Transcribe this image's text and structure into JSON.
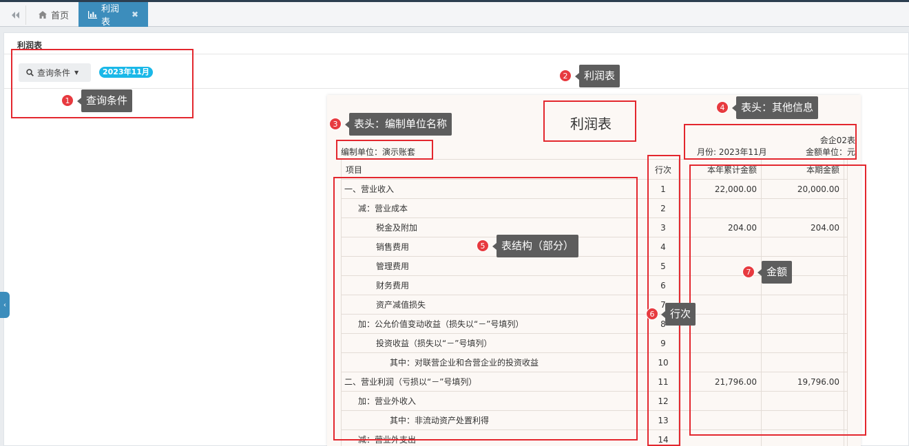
{
  "tabs": [
    {
      "label": "首页",
      "icon": "home-icon"
    },
    {
      "label": "利润表",
      "icon": "bar-chart-icon",
      "close": "✖"
    }
  ],
  "panel": {
    "title": "利润表",
    "query_button": "查询条件",
    "period": "2023年11月"
  },
  "report": {
    "title": "利润表",
    "form_no": "会企02表",
    "company": "编制单位：演示账套",
    "month": "月份: 2023年11月",
    "unit": "金额单位：元",
    "columns": {
      "item": "项目",
      "line": "行次",
      "ytd": "本年累计金额",
      "current": "本期金额"
    },
    "rows": [
      {
        "item": "一、营业收入",
        "line": "1",
        "ytd": "22,000.00",
        "current": "20,000.00",
        "bold": true,
        "indent": 0
      },
      {
        "item": "减：营业成本",
        "line": "2",
        "ytd": "",
        "current": "",
        "bold": false,
        "indent": 1
      },
      {
        "item": "税金及附加",
        "line": "3",
        "ytd": "204.00",
        "current": "204.00",
        "bold": false,
        "indent": 2
      },
      {
        "item": "销售费用",
        "line": "4",
        "ytd": "",
        "current": "",
        "bold": false,
        "indent": 2
      },
      {
        "item": "管理费用",
        "line": "5",
        "ytd": "",
        "current": "",
        "bold": false,
        "indent": 2
      },
      {
        "item": "财务费用",
        "line": "6",
        "ytd": "",
        "current": "",
        "bold": false,
        "indent": 2
      },
      {
        "item": "资产减值损失",
        "line": "7",
        "ytd": "",
        "current": "",
        "bold": false,
        "indent": 2
      },
      {
        "item": "加：公允价值变动收益（损失以“－”号填列）",
        "line": "8",
        "ytd": "",
        "current": "",
        "bold": false,
        "indent": 1
      },
      {
        "item": "投资收益（损失以“－”号填列）",
        "line": "9",
        "ytd": "",
        "current": "",
        "bold": false,
        "indent": 2
      },
      {
        "item": "其中：对联营企业和合营企业的投资收益",
        "line": "10",
        "ytd": "",
        "current": "",
        "bold": false,
        "indent": 3
      },
      {
        "item": "二、营业利润（亏损以“－”号填列）",
        "line": "11",
        "ytd": "21,796.00",
        "current": "19,796.00",
        "bold": true,
        "indent": 0
      },
      {
        "item": "加：营业外收入",
        "line": "12",
        "ytd": "",
        "current": "",
        "bold": false,
        "indent": 1
      },
      {
        "item": "其中：非流动资产处置利得",
        "line": "13",
        "ytd": "",
        "current": "",
        "bold": false,
        "indent": 3
      },
      {
        "item": "减：营业外支出",
        "line": "14",
        "ytd": "",
        "current": "",
        "bold": false,
        "indent": 1
      }
    ]
  },
  "annotations": [
    {
      "num": "1",
      "label": "查询条件"
    },
    {
      "num": "2",
      "label": "利润表"
    },
    {
      "num": "3",
      "label": "表头：编制单位名称"
    },
    {
      "num": "4",
      "label": "表头：其他信息"
    },
    {
      "num": "5",
      "label": "表结构（部分）"
    },
    {
      "num": "6",
      "label": "行次"
    },
    {
      "num": "7",
      "label": "金额"
    }
  ],
  "colors": {
    "accent": "#3c8dbc",
    "badge": "#1ab8e8",
    "annotation": "#e3262d",
    "label_bg": "#5d5d5d"
  }
}
